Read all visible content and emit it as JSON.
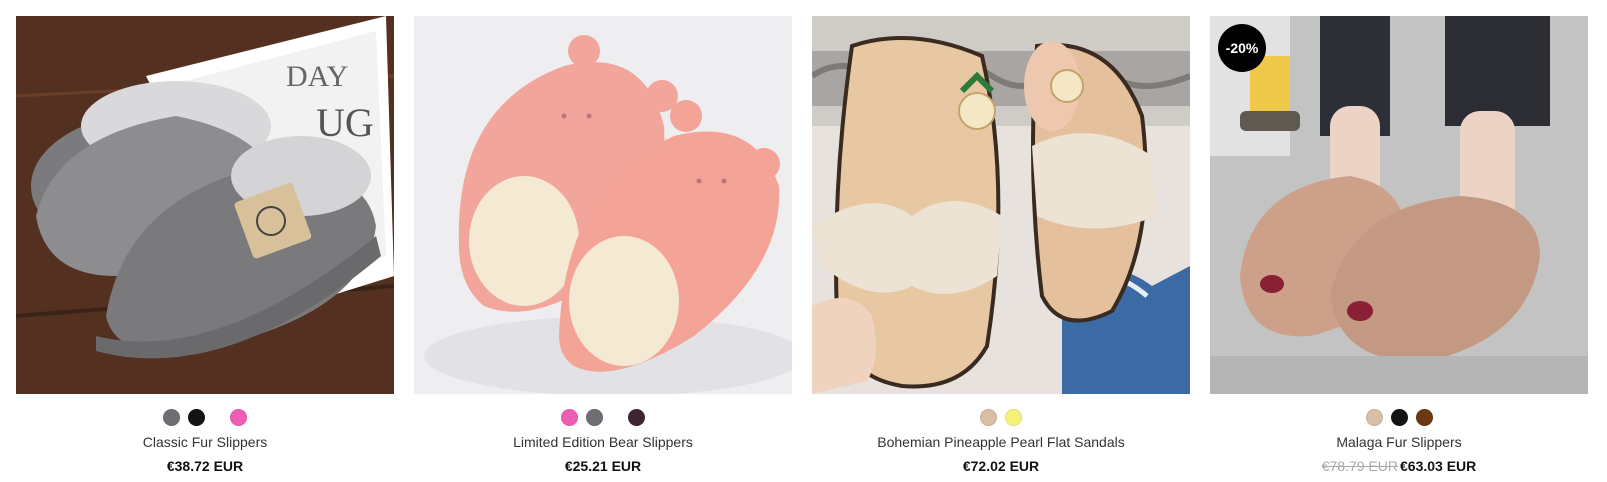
{
  "products": [
    {
      "title": "Classic Fur Slippers",
      "price": "€38.72 EUR",
      "swatches": [
        "#6f6f73",
        "#141414",
        "#ee5fb3"
      ]
    },
    {
      "title": "Limited Edition Bear Slippers",
      "price": "€25.21 EUR",
      "swatches": [
        "#ee5fb3",
        "#6f6f73",
        "#3f2432"
      ]
    },
    {
      "title": "Bohemian Pineapple Pearl Flat Sandals",
      "price": "€72.02 EUR",
      "swatches": [
        "#d8bea4",
        "#f5f27a"
      ]
    },
    {
      "title": "Malaga Fur Slippers",
      "badge": "-20%",
      "old_price": "€78.79 EUR",
      "price": "€63.03 EUR",
      "swatches": [
        "#d8bea4",
        "#141414",
        "#6b3814"
      ]
    }
  ]
}
